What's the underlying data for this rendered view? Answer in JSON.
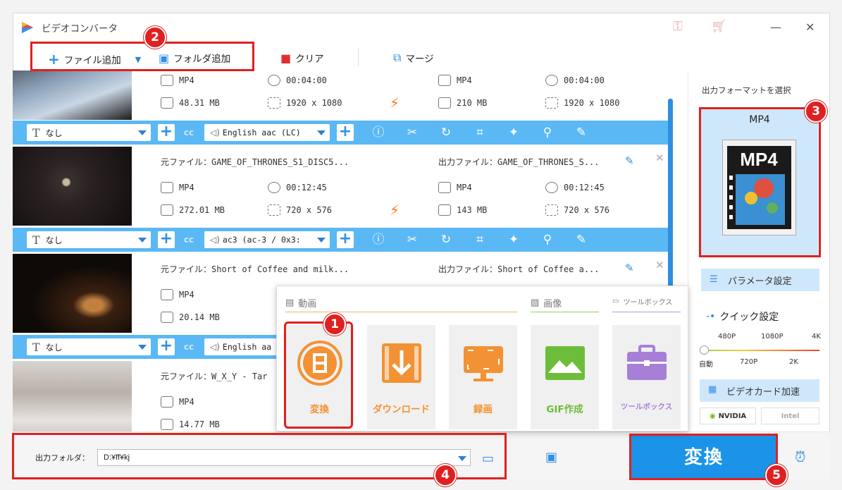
{
  "app": {
    "title": "ビデオコンバータ"
  },
  "toolbar": {
    "add_file": "ファイル追加",
    "add_folder": "フォルダ追加",
    "clear": "クリア",
    "merge": "マージ"
  },
  "files": [
    {
      "src_name": "",
      "dst_name": "",
      "src_format": "MP4",
      "src_duration": "00:04:00",
      "src_size": "48.31 MB",
      "src_res": "1920 x 1080",
      "dst_format": "MP4",
      "dst_duration": "00:04:00",
      "dst_size": "210 MB",
      "dst_res": "1920 x 1080",
      "subtitle": "なし",
      "audio": "English aac (LC)"
    },
    {
      "src_label": "元ファイル：",
      "src_name": "GAME_OF_THRONES_S1_DISC5...",
      "dst_label": "出力ファイル：",
      "dst_name": "GAME_OF_THRONES_S...",
      "src_format": "MP4",
      "src_duration": "00:12:45",
      "src_size": "272.01 MB",
      "src_res": "720 x 576",
      "dst_format": "MP4",
      "dst_duration": "00:12:45",
      "dst_size": "143 MB",
      "dst_res": "720 x 576",
      "subtitle": "なし",
      "audio": "ac3 (ac-3 / 0x3:"
    },
    {
      "src_label": "元ファイル：",
      "src_name": "Short of Coffee and milk...",
      "dst_label": "出力ファイル：",
      "dst_name": "Short of Coffee a...",
      "src_format": "MP4",
      "src_size": "20.14 MB",
      "subtitle": "なし",
      "audio": "English aa"
    },
    {
      "src_label": "元ファイル：",
      "src_name": "W_X_Y - Tar",
      "src_format": "MP4",
      "src_size": "14.77 MB"
    }
  ],
  "right_panel": {
    "select_format_label": "出力フォーマットを選択",
    "format_name": "MP4",
    "format_icon_text": "MP4",
    "param_button": "パラメータ設定",
    "quick_label": "クイック設定",
    "quick_top": [
      "480P",
      "1080P",
      "4K"
    ],
    "quick_bottom": [
      "自動",
      "720P",
      "2K"
    ],
    "gpu_button": "ビデオカード加速",
    "chips": [
      "NVIDIA",
      "Intel"
    ]
  },
  "popup": {
    "section_video": "動画",
    "section_image": "画像",
    "section_toolbox": "ツールボックス",
    "tiles": [
      "変換",
      "ダウンロード",
      "録画",
      "GIF作成",
      "ツールボックス"
    ]
  },
  "bottom": {
    "output_label": "出力フォルダ：",
    "output_path": "D:¥ff¥kj",
    "convert": "変換"
  },
  "callouts": [
    "1",
    "2",
    "3",
    "4",
    "5"
  ],
  "colors": {
    "accent": "#5ab8f5",
    "primary": "#1a93e8",
    "callout": "#e02020",
    "tile_orange": "#f29234"
  }
}
